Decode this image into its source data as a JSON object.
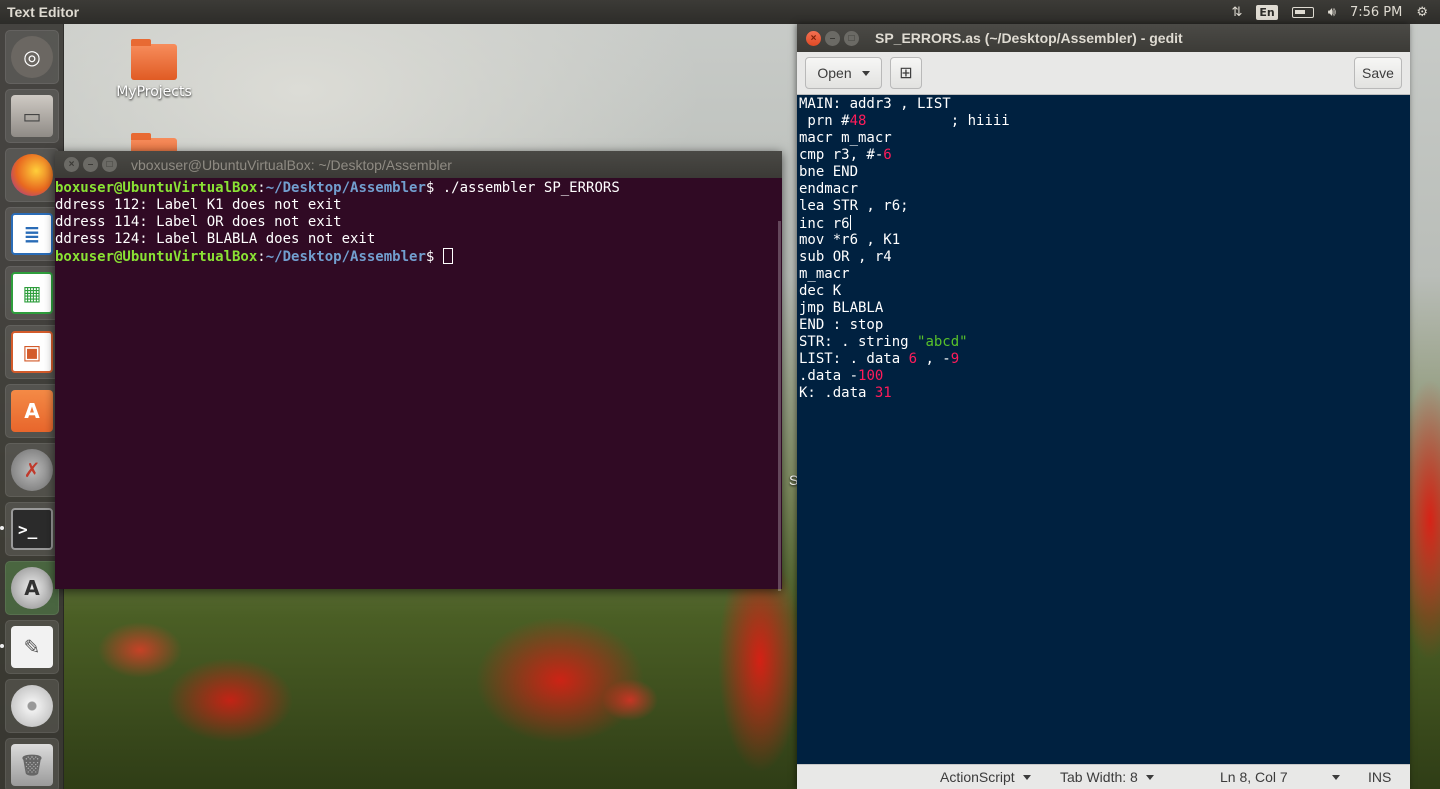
{
  "topbar": {
    "app_title": "Text Editor",
    "keyboard_layout": "En",
    "clock": "7:56 PM"
  },
  "launcher": {
    "items": [
      {
        "name": "Dash Home",
        "icon": "ubuntu-logo-icon",
        "color": "#5a5753"
      },
      {
        "name": "Files",
        "icon": "file-cabinet-icon",
        "color": "#8f8b86"
      },
      {
        "name": "Firefox",
        "icon": "firefox-icon",
        "color": "#e8671f"
      },
      {
        "name": "LibreOffice Writer",
        "icon": "writer-doc-icon",
        "color": "#2a6cb7"
      },
      {
        "name": "LibreOffice Calc",
        "icon": "calc-sheet-icon",
        "color": "#2e9e3c"
      },
      {
        "name": "LibreOffice Impress",
        "icon": "impress-slide-icon",
        "color": "#d35b2b"
      },
      {
        "name": "Ubuntu Software",
        "icon": "shopping-bag-icon",
        "color": "#e8662c"
      },
      {
        "name": "System Settings",
        "icon": "settings-wrench-icon",
        "color": "#7d7d7d"
      },
      {
        "name": "Terminal",
        "icon": "terminal-prompt-icon",
        "color": "#2b2b2b"
      },
      {
        "name": "Software Updater",
        "icon": "updater-icon",
        "color": "#4d4d4d"
      },
      {
        "name": "Text Editor",
        "icon": "text-editor-icon",
        "color": "#e6e6e6"
      },
      {
        "name": "DVD",
        "icon": "optical-disc-icon",
        "color": "#cfcfcf"
      },
      {
        "name": "Trash",
        "icon": "trash-icon",
        "color": "#9a9a9a"
      }
    ]
  },
  "desktop": {
    "icons": [
      {
        "label": "MyProjects",
        "icon": "folder-icon"
      }
    ],
    "edge_text": "S"
  },
  "terminal": {
    "title": "vboxuser@UbuntuVirtualBox: ~/Desktop/Assembler",
    "lines": [
      {
        "user": "boxuser@UbuntuVirtualBox",
        "path": "~/Desktop/Assembler",
        "command": "$ ./assembler SP_ERRORS"
      },
      {
        "text": "ddress 112: Label K1 does not exit"
      },
      {
        "text": "ddress 114: Label OR does not exit"
      },
      {
        "text": "ddress 124: Label BLABLA does not exit"
      },
      {
        "user": "boxuser@UbuntuVirtualBox",
        "path": "~/Desktop/Assembler",
        "command": "$ "
      }
    ]
  },
  "gedit": {
    "title": "SP_ERRORS.as (~/Desktop/Assembler) - gedit",
    "toolbar": {
      "open_label": "Open",
      "save_label": "Save"
    },
    "code": [
      [
        {
          "t": "MAIN: addr3 , LIST"
        }
      ],
      [
        {
          "t": " prn #"
        },
        {
          "t": "48",
          "k": "num"
        },
        {
          "t": "          ; hiiii"
        }
      ],
      [
        {
          "t": "macr m_macr"
        }
      ],
      [
        {
          "t": "cmp r3, #-"
        },
        {
          "t": "6",
          "k": "num"
        }
      ],
      [
        {
          "t": "bne END"
        }
      ],
      [
        {
          "t": "endmacr"
        }
      ],
      [
        {
          "t": "lea STR , r6;"
        }
      ],
      [
        {
          "t": "inc r6"
        }
      ],
      [
        {
          "t": "mov *r6 , K1"
        }
      ],
      [
        {
          "t": "sub OR , r4"
        }
      ],
      [
        {
          "t": "m_macr"
        }
      ],
      [
        {
          "t": "dec K"
        }
      ],
      [
        {
          "t": "jmp BLABLA"
        }
      ],
      [
        {
          "t": "END : stop"
        }
      ],
      [
        {
          "t": "STR: . string "
        },
        {
          "t": "\"abcd\"",
          "k": "str"
        }
      ],
      [
        {
          "t": "LIST: . data "
        },
        {
          "t": "6",
          "k": "num"
        },
        {
          "t": " , -"
        },
        {
          "t": "9",
          "k": "num"
        }
      ],
      [
        {
          "t": ".data -"
        },
        {
          "t": "100",
          "k": "num"
        }
      ],
      [
        {
          "t": "K: .data "
        },
        {
          "t": "31",
          "k": "num"
        }
      ]
    ],
    "cursor_line": 8,
    "statusbar": {
      "language": "ActionScript",
      "tab_width": "Tab Width: 8",
      "position": "Ln 8, Col 7",
      "mode": "INS"
    },
    "colors": {
      "background": "#002140",
      "number": "#ff1c5a",
      "string": "#58c12a"
    }
  }
}
